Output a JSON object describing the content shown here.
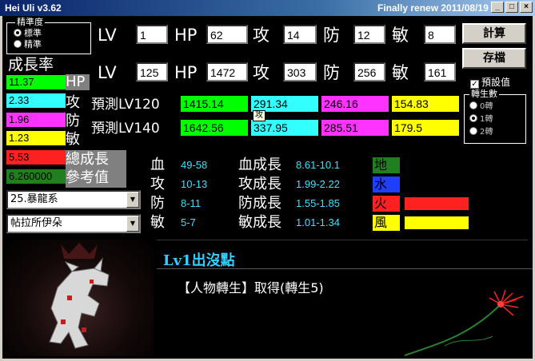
{
  "window": {
    "title": "Hei Uli   v3.62",
    "subtitle": "Finally renew 2011/08/19"
  },
  "accuracy": {
    "legend": "精準度",
    "options": [
      "標準",
      "精準"
    ],
    "selected": 0
  },
  "stats_labels": {
    "lv": "LV",
    "hp": "HP",
    "atk": "攻",
    "def": "防",
    "agi": "敏"
  },
  "row1": {
    "lv": "1",
    "hp": "62",
    "atk": "14",
    "def": "12",
    "agi": "8"
  },
  "row2": {
    "lv": "125",
    "hp": "1472",
    "atk": "303",
    "def": "256",
    "agi": "161"
  },
  "buttons": {
    "calc": "計算",
    "save": "存檔"
  },
  "default_checkbox": {
    "label": "預設值",
    "checked": true
  },
  "rebirth": {
    "legend": "轉生數",
    "options": [
      "0轉",
      "1轉",
      "2轉"
    ],
    "selected": 1
  },
  "growth": {
    "title": "成長率",
    "values": [
      "11.37",
      "2.33",
      "1.96",
      "1.23",
      "5.53",
      "6.260000"
    ],
    "colors": [
      "#00ff00",
      "#33ffff",
      "#ff33ff",
      "#ffff00",
      "#ff2020",
      "#208020"
    ],
    "labels": [
      "HP",
      "攻",
      "防",
      "敏",
      "總成長",
      "參考值"
    ]
  },
  "prediction": {
    "lv120_label": "預測LV120",
    "lv140_label": "預測LV140",
    "lv120": [
      "1415.14",
      "291.34",
      "246.16",
      "154.83"
    ],
    "lv140": [
      "1642.56",
      "337.95",
      "285.51",
      "179.5"
    ],
    "colors": [
      "#00ff00",
      "#33ffff",
      "#ff33ff",
      "#ffff00"
    ],
    "tooltip": "攻"
  },
  "pet_select": {
    "selected": "25.暴龍系"
  },
  "location_select": {
    "selected": "帖拉所伊朵"
  },
  "base_ranges": [
    {
      "k": "血",
      "v": "49-58"
    },
    {
      "k": "攻",
      "v": "10-13"
    },
    {
      "k": "防",
      "v": "8-11"
    },
    {
      "k": "敏",
      "v": "5-7"
    }
  ],
  "growth_ranges": [
    {
      "k": "血成長",
      "v": "8.61-10.1"
    },
    {
      "k": "攻成長",
      "v": "1.99-2.22"
    },
    {
      "k": "防成長",
      "v": "1.55-1.85"
    },
    {
      "k": "敏成長",
      "v": "1.01-1.34"
    }
  ],
  "elements": [
    {
      "name": "地",
      "color": "#208020",
      "level": 0
    },
    {
      "name": "水",
      "color": "#1f3fff",
      "level": 0
    },
    {
      "name": "火",
      "color": "#ff2020",
      "level": 0.5
    },
    {
      "name": "風",
      "color": "#ffff00",
      "level": 0.5
    }
  ],
  "respawn": {
    "title": "Lv1出沒點",
    "text": "【人物轉生】取得(轉生5)"
  }
}
